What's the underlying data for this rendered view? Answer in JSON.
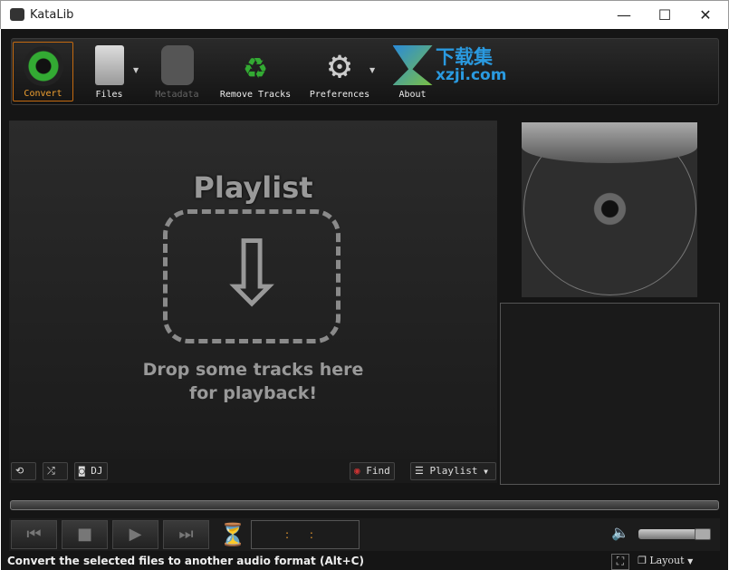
{
  "window": {
    "title": "KataLib",
    "minimize": "—",
    "maximize": "☐",
    "close": "✕"
  },
  "toolbar": {
    "items": [
      {
        "label": "Convert",
        "icon": "convert-icon",
        "state": "active"
      },
      {
        "label": "Files",
        "icon": "files-icon",
        "dropdown": true
      },
      {
        "label": "Metadata",
        "icon": "database-search-icon",
        "state": "disabled"
      },
      {
        "label": "Remove Tracks",
        "icon": "recycle-icon"
      },
      {
        "label": "Preferences",
        "icon": "gear-icon",
        "dropdown": true
      },
      {
        "label": "About",
        "icon": "about-icon"
      }
    ],
    "watermark": {
      "cn": "下载集",
      "url": "xzji.com"
    }
  },
  "playlist": {
    "title": "Playlist",
    "drop_line1": "Drop some tracks here",
    "drop_line2": "for playback!",
    "arrow": "⇩"
  },
  "playlist_bar": {
    "dj": "DJ",
    "find": "Find",
    "playlist": "Playlist"
  },
  "player": {
    "prev": "⏮",
    "stop": "■",
    "play": "▶",
    "next": "⏭",
    "time": ":      :",
    "volume_percent": 100,
    "volume_icon": "🔈"
  },
  "status": {
    "text": "Convert the selected files to another audio format (Alt+C)",
    "layout": "Layout"
  },
  "colors": {
    "accent": "#f0a030",
    "background": "#151515"
  }
}
